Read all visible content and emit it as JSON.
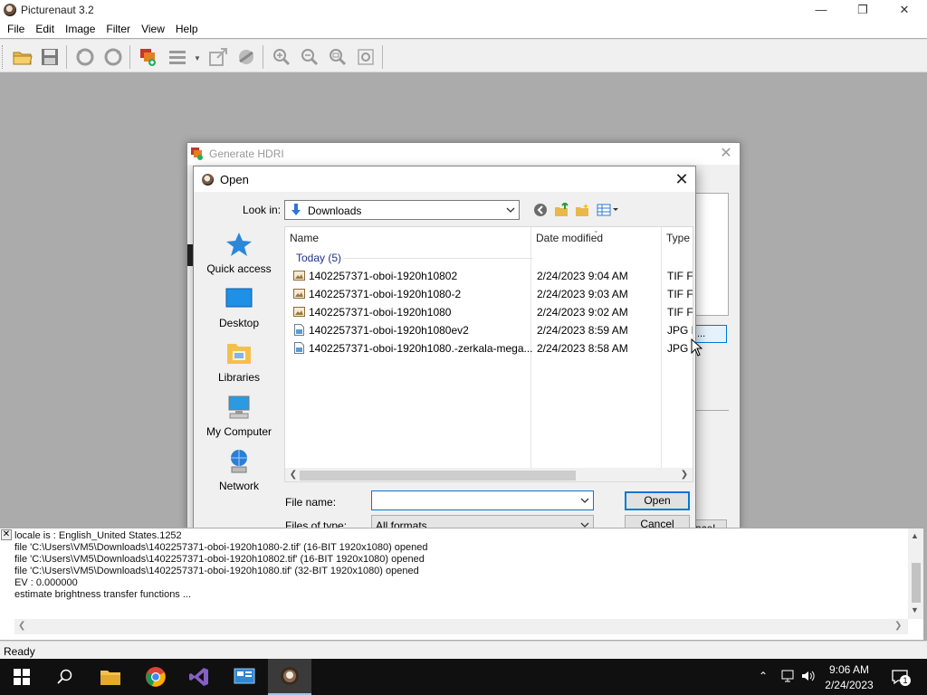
{
  "app": {
    "title": "Picturenaut 3.2",
    "menu": [
      "File",
      "Edit",
      "Image",
      "Filter",
      "View",
      "Help"
    ]
  },
  "hdri_dialog": {
    "title": "Generate HDRI",
    "button_partial": "...",
    "cancel_partial": "ncel"
  },
  "open_dialog": {
    "title": "Open",
    "look_in_label": "Look in:",
    "look_in_value": "Downloads",
    "places": [
      {
        "label": "Quick access",
        "icon": "quick-access-icon"
      },
      {
        "label": "Desktop",
        "icon": "desktop-icon"
      },
      {
        "label": "Libraries",
        "icon": "libraries-icon"
      },
      {
        "label": "My Computer",
        "icon": "computer-icon"
      },
      {
        "label": "Network",
        "icon": "network-icon"
      }
    ],
    "columns": {
      "name": "Name",
      "date": "Date modified",
      "type": "Type"
    },
    "group": "Today (5)",
    "files": [
      {
        "name": "1402257371-oboi-1920h10802",
        "date": "2/24/2023 9:04 AM",
        "type": "TIF Fi",
        "kind": "tif"
      },
      {
        "name": "1402257371-oboi-1920h1080-2",
        "date": "2/24/2023 9:03 AM",
        "type": "TIF Fi",
        "kind": "tif"
      },
      {
        "name": "1402257371-oboi-1920h1080",
        "date": "2/24/2023 9:02 AM",
        "type": "TIF Fi",
        "kind": "tif"
      },
      {
        "name": "1402257371-oboi-1920h1080ev2",
        "date": "2/24/2023 8:59 AM",
        "type": "JPG F",
        "kind": "jpg"
      },
      {
        "name": "1402257371-oboi-1920h1080.-zerkala-mega...",
        "date": "2/24/2023 8:58 AM",
        "type": "JPG F",
        "kind": "jpg"
      }
    ],
    "file_name_label": "File name:",
    "file_name_value": "",
    "file_type_label": "Files of type:",
    "file_type_value": "All formats",
    "open_button": "Open",
    "cancel_button": "Cancel"
  },
  "log": {
    "lines": [
      "locale is : English_United States.1252",
      "file 'C:\\Users\\VM5\\Downloads\\1402257371-oboi-1920h1080-2.tif' (16-BIT 1920x1080) opened",
      "file 'C:\\Users\\VM5\\Downloads\\1402257371-oboi-1920h10802.tif' (16-BIT 1920x1080) opened",
      "file 'C:\\Users\\VM5\\Downloads\\1402257371-oboi-1920h1080.tif' (32-BIT 1920x1080) opened",
      "EV : 0.000000",
      "estimate brightness transfer functions ..."
    ]
  },
  "status": {
    "text": "Ready"
  },
  "taskbar": {
    "time": "9:06 AM",
    "date": "2/24/2023",
    "notification_count": "1"
  },
  "colors": {
    "accent": "#0078d7",
    "workspace": "#ababab",
    "taskbar": "#101010",
    "group_header": "#1e3287"
  }
}
